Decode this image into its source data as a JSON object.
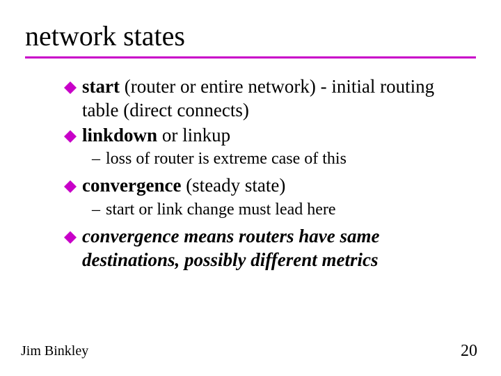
{
  "title": "network states",
  "bullets": {
    "b1": {
      "strong": "start",
      "rest": " (router or entire network) - initial routing table (direct connects)"
    },
    "b2": {
      "strong": "linkdown",
      "rest": " or linkup"
    },
    "s2": "loss of router is extreme case of this",
    "b3": {
      "strong": "convergence",
      "rest": "  (steady state)"
    },
    "s3": "start or link change must lead here",
    "b4": {
      "strong": "convergence",
      "rest": " means routers have same destinations, possibly different metrics"
    }
  },
  "footer": {
    "author": "Jim Binkley",
    "page": "20"
  },
  "colors": {
    "accent": "#c800c8"
  }
}
